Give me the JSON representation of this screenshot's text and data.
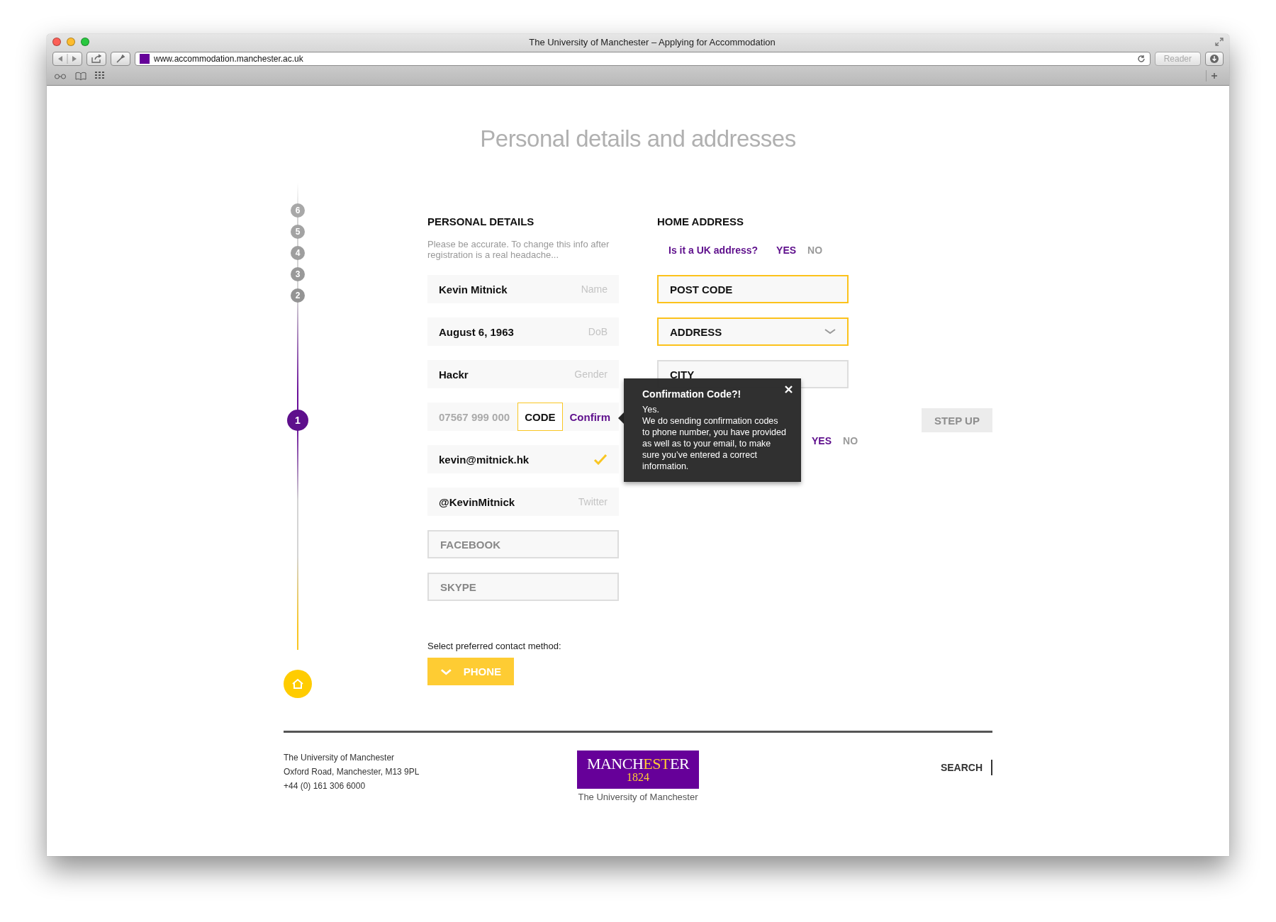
{
  "browser": {
    "title": "The University of Manchester – Applying for Accommodation",
    "url": "www.accommodation.manchester.ac.uk",
    "reader_button": "Reader"
  },
  "page_title": "Personal details and addresses",
  "steps": [
    {
      "label": "6",
      "selected": false
    },
    {
      "label": "5",
      "selected": false
    },
    {
      "label": "4",
      "selected": false
    },
    {
      "label": "3",
      "selected": false
    },
    {
      "label": "2",
      "selected": false
    },
    {
      "label": "1",
      "selected": true
    }
  ],
  "personal": {
    "heading": "PERSONAL DETAILS",
    "hint": "Please be accurate. To change this info after registration is a real headache...",
    "fields": [
      {
        "kind": "filled",
        "value": "Kevin Mitnick",
        "label": "Name"
      },
      {
        "kind": "filled",
        "value": "August 6, 1963",
        "label": "DoB"
      },
      {
        "kind": "filled",
        "value": "Hackr",
        "label": "Gender"
      },
      {
        "kind": "phone",
        "value": "07567 999 000",
        "code": "CODE",
        "action": "Confirm"
      },
      {
        "kind": "verified",
        "value": "kevin@mitnick.hk"
      },
      {
        "kind": "filled",
        "value": "@KevinMitnick",
        "label": "Twitter"
      },
      {
        "kind": "empty",
        "placeholder": "FACEBOOK"
      },
      {
        "kind": "empty",
        "placeholder": "SKYPE"
      }
    ],
    "contact_label": "Select preferred contact method:",
    "contact_button": "PHONE"
  },
  "home": {
    "heading": "HOME ADDRESS",
    "question": "Is it a UK address?",
    "options": [
      {
        "label": "YES",
        "selected": true
      },
      {
        "label": "NO",
        "selected": false
      }
    ],
    "fields": [
      {
        "kind": "text",
        "placeholder": "POST CODE",
        "highlighted": true
      },
      {
        "kind": "select",
        "placeholder": "ADDRESS",
        "highlighted": true
      },
      {
        "kind": "text",
        "placeholder": "CITY",
        "highlighted": false
      }
    ]
  },
  "emergency": {
    "options": [
      {
        "label": "YES",
        "selected": true
      },
      {
        "label": "NO",
        "selected": false
      }
    ]
  },
  "step_up_button": "STEP UP",
  "tooltip": {
    "title": "Confirmation Code?!",
    "paragraphs": [
      "Yes.",
      "We do sending confirmation codes to phone number, you have provided as well as to your email, to make sure you’ve entered a correct information."
    ]
  },
  "footer": {
    "address_lines": [
      "The University of Manchester",
      "Oxford Road, Manchester, M13 9PL",
      "+44 (0) 161 306 6000"
    ],
    "logo_parts": [
      {
        "text": "MANCH",
        "highlight": false
      },
      {
        "text": "EST",
        "highlight": true
      },
      {
        "text": "ER",
        "highlight": false
      }
    ],
    "logo_year": "1824",
    "logo_caption": "The University of Manchester",
    "search_link": "SEARCH"
  }
}
